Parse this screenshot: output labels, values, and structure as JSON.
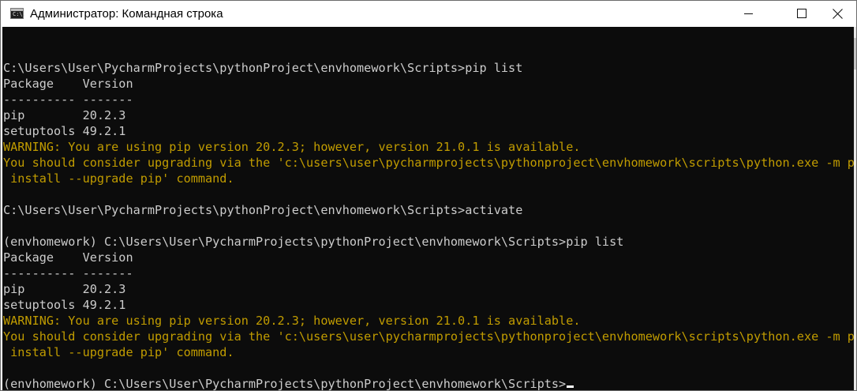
{
  "window": {
    "title": "Администратор: Командная строка",
    "icon": "cmd-icon",
    "icon_glyph": "C:\\."
  },
  "colors": {
    "console_background": "#0c0c0c",
    "console_text": "#cccccc",
    "warning_text": "#c19c00"
  },
  "console": {
    "lines": [
      {
        "text": "",
        "type": "blank"
      },
      {
        "text": "C:\\Users\\User\\PycharmProjects\\pythonProject\\envhomework\\Scripts>pip list",
        "type": "command"
      },
      {
        "text": "Package    Version",
        "type": "output"
      },
      {
        "text": "---------- -------",
        "type": "output"
      },
      {
        "text": "pip        20.2.3",
        "type": "output"
      },
      {
        "text": "setuptools 49.2.1",
        "type": "output"
      },
      {
        "text": "WARNING: You are using pip version 20.2.3; however, version 21.0.1 is available.",
        "type": "warning"
      },
      {
        "text": "You should consider upgrading via the 'c:\\users\\user\\pycharmprojects\\pythonproject\\envhomework\\scripts\\python.exe -m pip",
        "type": "warning"
      },
      {
        "text": " install --upgrade pip' command.",
        "type": "warning"
      },
      {
        "text": "",
        "type": "blank"
      },
      {
        "text": "C:\\Users\\User\\PycharmProjects\\pythonProject\\envhomework\\Scripts>activate",
        "type": "command"
      },
      {
        "text": "",
        "type": "blank"
      },
      {
        "text": "(envhomework) C:\\Users\\User\\PycharmProjects\\pythonProject\\envhomework\\Scripts>pip list",
        "type": "command"
      },
      {
        "text": "Package    Version",
        "type": "output"
      },
      {
        "text": "---------- -------",
        "type": "output"
      },
      {
        "text": "pip        20.2.3",
        "type": "output"
      },
      {
        "text": "setuptools 49.2.1",
        "type": "output"
      },
      {
        "text": "WARNING: You are using pip version 20.2.3; however, version 21.0.1 is available.",
        "type": "warning"
      },
      {
        "text": "You should consider upgrading via the 'c:\\users\\user\\pycharmprojects\\pythonproject\\envhomework\\scripts\\python.exe -m pip",
        "type": "warning"
      },
      {
        "text": " install --upgrade pip' command.",
        "type": "warning"
      },
      {
        "text": "",
        "type": "blank"
      },
      {
        "text": "(envhomework) C:\\Users\\User\\PycharmProjects\\pythonProject\\envhomework\\Scripts>",
        "type": "prompt"
      }
    ]
  }
}
